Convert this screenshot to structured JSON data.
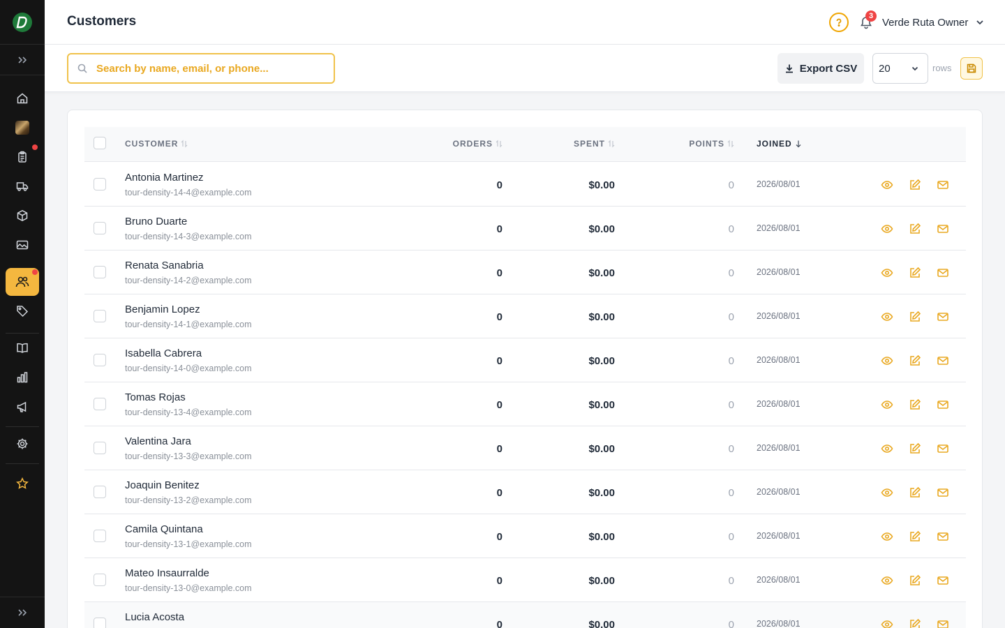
{
  "header": {
    "title": "Customers",
    "notification_count": "3",
    "user_name": "Verde Ruta Owner"
  },
  "toolbar": {
    "search_placeholder": "Search by name, email, or phone...",
    "export_label": "Export CSV",
    "rows_value": "20",
    "rows_label": "rows"
  },
  "sidebar": {
    "items": [
      {
        "name": "home",
        "icon": "home-icon"
      },
      {
        "name": "profile-photo",
        "icon": "photo-icon"
      },
      {
        "name": "orders",
        "icon": "clipboard-icon",
        "dot": true
      },
      {
        "name": "delivery",
        "icon": "truck-icon"
      },
      {
        "name": "products",
        "icon": "box-icon"
      },
      {
        "name": "media",
        "icon": "image-icon"
      },
      {
        "name": "customers",
        "icon": "users-icon",
        "active": true,
        "dot": true
      },
      {
        "name": "discounts",
        "icon": "tag-icon"
      },
      {
        "name": "catalog",
        "icon": "book-icon"
      },
      {
        "name": "analytics",
        "icon": "bar-chart-icon"
      },
      {
        "name": "marketing",
        "icon": "megaphone-icon"
      },
      {
        "name": "settings",
        "icon": "gear-icon"
      },
      {
        "name": "premium",
        "icon": "star-icon"
      }
    ]
  },
  "table": {
    "columns": {
      "customer": "CUSTOMER",
      "orders": "ORDERS",
      "spent": "SPENT",
      "points": "POINTS",
      "joined": "JOINED"
    },
    "rows": [
      {
        "name": "Antonia Martinez",
        "email": "tour-density-14-4@example.com",
        "orders": "0",
        "spent": "$0.00",
        "points": "0",
        "joined": "2026/08/01"
      },
      {
        "name": "Bruno Duarte",
        "email": "tour-density-14-3@example.com",
        "orders": "0",
        "spent": "$0.00",
        "points": "0",
        "joined": "2026/08/01"
      },
      {
        "name": "Renata Sanabria",
        "email": "tour-density-14-2@example.com",
        "orders": "0",
        "spent": "$0.00",
        "points": "0",
        "joined": "2026/08/01"
      },
      {
        "name": "Benjamin Lopez",
        "email": "tour-density-14-1@example.com",
        "orders": "0",
        "spent": "$0.00",
        "points": "0",
        "joined": "2026/08/01"
      },
      {
        "name": "Isabella Cabrera",
        "email": "tour-density-14-0@example.com",
        "orders": "0",
        "spent": "$0.00",
        "points": "0",
        "joined": "2026/08/01"
      },
      {
        "name": "Tomas Rojas",
        "email": "tour-density-13-4@example.com",
        "orders": "0",
        "spent": "$0.00",
        "points": "0",
        "joined": "2026/08/01"
      },
      {
        "name": "Valentina Jara",
        "email": "tour-density-13-3@example.com",
        "orders": "0",
        "spent": "$0.00",
        "points": "0",
        "joined": "2026/08/01"
      },
      {
        "name": "Joaquin Benitez",
        "email": "tour-density-13-2@example.com",
        "orders": "0",
        "spent": "$0.00",
        "points": "0",
        "joined": "2026/08/01"
      },
      {
        "name": "Camila Quintana",
        "email": "tour-density-13-1@example.com",
        "orders": "0",
        "spent": "$0.00",
        "points": "0",
        "joined": "2026/08/01"
      },
      {
        "name": "Mateo Insaurralde",
        "email": "tour-density-13-0@example.com",
        "orders": "0",
        "spent": "$0.00",
        "points": "0",
        "joined": "2026/08/01"
      },
      {
        "name": "Lucia Acosta",
        "email": "",
        "orders": "0",
        "spent": "$0.00",
        "points": "0",
        "joined": "2026/08/01"
      }
    ]
  },
  "colors": {
    "accent": "#f4b73f",
    "sidebar_bg": "#141414",
    "badge": "#ef4444",
    "action_icon": "#e9a820"
  }
}
